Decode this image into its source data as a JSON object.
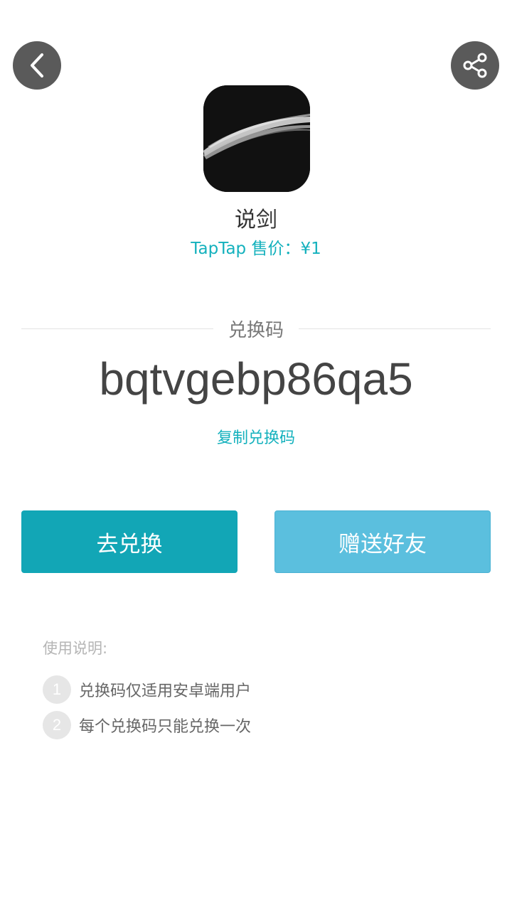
{
  "header": {
    "back_icon": "chevron-left-icon",
    "share_icon": "share-icon"
  },
  "app": {
    "name": "说剑",
    "price": "TapTap 售价：¥1",
    "accent_color": "#14b1bd"
  },
  "code_section": {
    "label": "兑换码",
    "code": "bqtvgebp86qa5",
    "copy_label": "复制兑换码"
  },
  "actions": {
    "redeem_label": "去兑换",
    "redeem_color": "#12a6b6",
    "gift_label": "赠送好友",
    "gift_color": "#5bbfde"
  },
  "usage": {
    "title": "使用说明:",
    "rules": [
      {
        "num": "1",
        "text": "兑换码仅适用安卓端用户"
      },
      {
        "num": "2",
        "text": "每个兑换码只能兑换一次"
      }
    ]
  }
}
